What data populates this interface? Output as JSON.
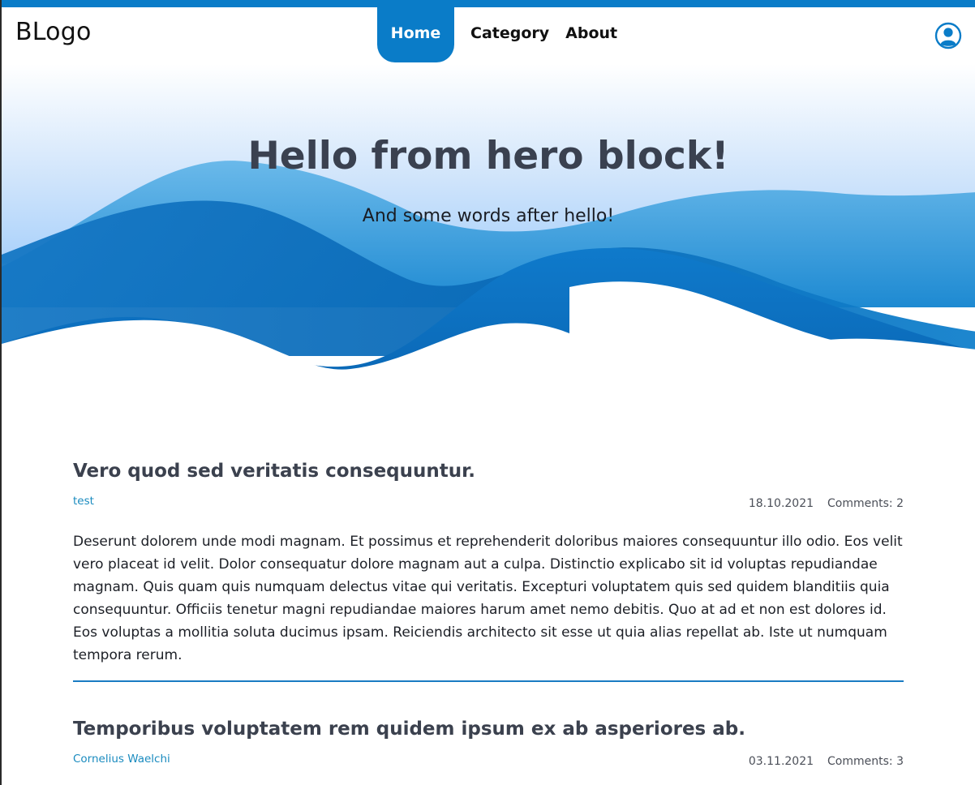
{
  "brand": {
    "logo": "BLogo",
    "accent": "#0a7cc8"
  },
  "nav": {
    "items": [
      {
        "label": "Home",
        "active": true
      },
      {
        "label": "Category",
        "active": false
      },
      {
        "label": "About",
        "active": false
      }
    ],
    "user_icon": "user-circle-icon"
  },
  "hero": {
    "title": "Hello from hero block!",
    "subtitle": "And some words after hello!"
  },
  "posts": [
    {
      "title": "Vero quod sed veritatis consequuntur.",
      "author": "test",
      "date": "18.10.2021",
      "comments": "Comments: 2",
      "body": "Deserunt dolorem unde modi magnam. Et possimus et reprehenderit doloribus maiores consequuntur illo odio. Eos velit vero placeat id velit. Dolor consequatur dolore magnam aut a culpa. Distinctio explicabo sit id voluptas repudiandae magnam. Quis quam quis numquam delectus vitae qui veritatis. Excepturi voluptatem quis sed quidem blanditiis quia consequuntur. Officiis tenetur magni repudiandae maiores harum amet nemo debitis. Quo at ad et non est dolores id. Eos voluptas a mollitia soluta ducimus ipsam. Reiciendis architecto sit esse ut quia alias repellat ab. Iste ut numquam tempora rerum."
    },
    {
      "title": "Temporibus voluptatem rem quidem ipsum ex ab asperiores ab.",
      "author": "Cornelius Waelchi",
      "date": "03.11.2021",
      "comments": "Comments: 3"
    }
  ]
}
